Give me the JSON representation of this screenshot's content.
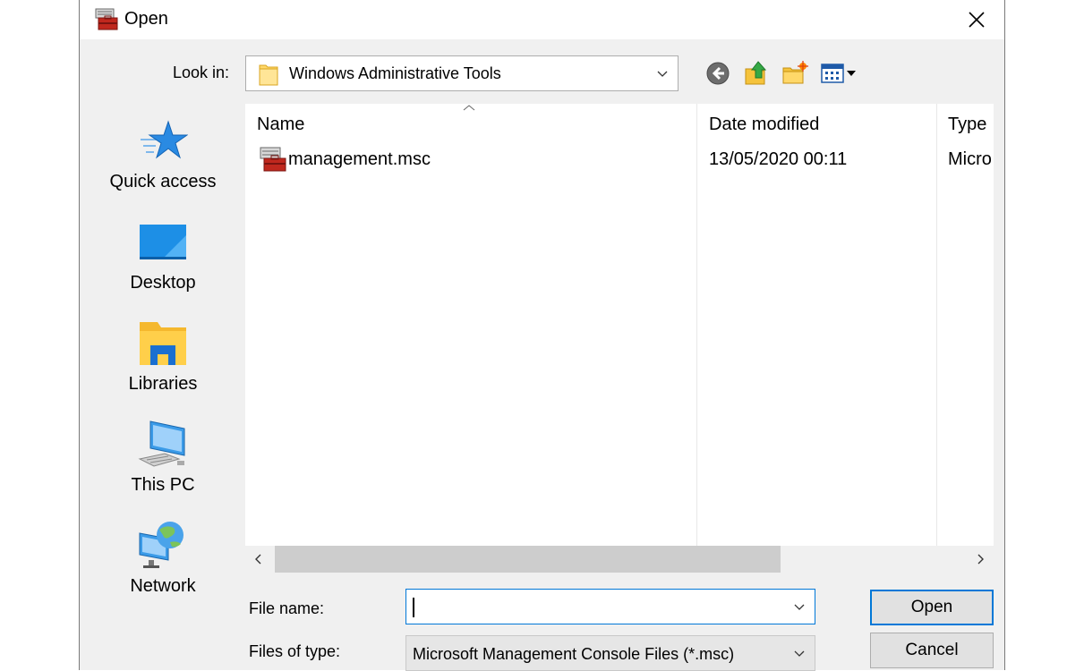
{
  "dialog": {
    "title": "Open"
  },
  "look_in": {
    "label": "Look in:",
    "value": "Windows Administrative Tools"
  },
  "toolbar": [
    "back-icon",
    "up-folder-icon",
    "new-folder-icon",
    "view-menu-icon"
  ],
  "places": [
    {
      "label": "Quick access",
      "icon": "star-icon"
    },
    {
      "label": "Desktop",
      "icon": "desktop-icon"
    },
    {
      "label": "Libraries",
      "icon": "libraries-icon"
    },
    {
      "label": "This PC",
      "icon": "computer-icon"
    },
    {
      "label": "Network",
      "icon": "network-icon"
    }
  ],
  "columns": {
    "name": "Name",
    "date": "Date modified",
    "type": "Type"
  },
  "files": [
    {
      "name": "management.msc",
      "date": "13/05/2020 00:11",
      "type": "Micro"
    }
  ],
  "file_name": {
    "label": "File name:",
    "value": ""
  },
  "file_type": {
    "label": "Files of type:",
    "value": "Microsoft Management Console Files (*.msc)"
  },
  "buttons": {
    "open": "Open",
    "cancel": "Cancel"
  },
  "colors": {
    "accent": "#0078d7",
    "dialog_bg": "#f0f0f0"
  }
}
